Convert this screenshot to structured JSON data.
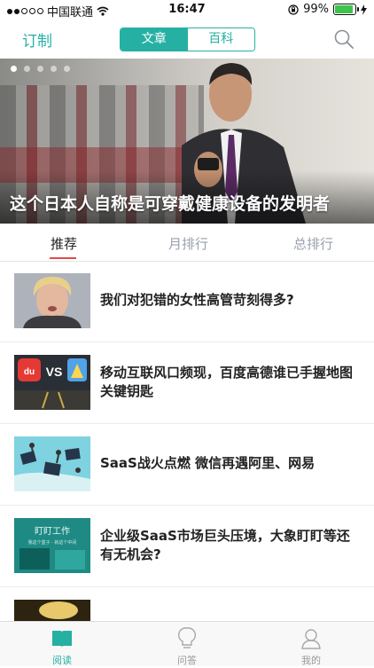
{
  "status": {
    "carrier": "中国联通",
    "time": "16:47",
    "battery": "99%"
  },
  "nav": {
    "subscribe": "订制",
    "seg_active": "文章",
    "seg_other": "百科"
  },
  "hero": {
    "title": "这个日本人自称是可穿戴健康设备的发明者",
    "page_count": 5,
    "current_page": 1
  },
  "tabs": [
    {
      "label": "推荐"
    },
    {
      "label": "月排行"
    },
    {
      "label": "总排行"
    }
  ],
  "articles": [
    {
      "title": "我们对犯错的女性高管苛刻得多?"
    },
    {
      "title": "移动互联风口频现，百度高德谁已手握地图关键钥匙"
    },
    {
      "title": "SaaS战火点燃 微信再遇阿里、网易"
    },
    {
      "title": "企业级SaaS市场巨头压境，大象盯盯等还有无机会?"
    },
    {
      "title": ""
    }
  ],
  "thumb_text": {
    "du": "du",
    "vs": "VS",
    "dingding": "盯盯工作",
    "dingding_sub": "我这个盒子 · 就这个中间"
  },
  "tabbar": [
    {
      "label": "阅读"
    },
    {
      "label": "问答"
    },
    {
      "label": "我的"
    }
  ],
  "colors": {
    "accent": "#26b0a3",
    "tab_indicator": "#e04a4a",
    "inactive": "#9aa0ad"
  }
}
